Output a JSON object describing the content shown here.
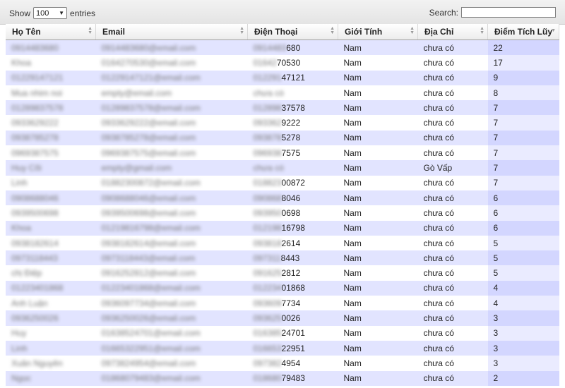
{
  "controls": {
    "show_label": "Show",
    "page_size": "100",
    "entries_label": "entries",
    "search_label": "Search:",
    "search_value": ""
  },
  "columns": [
    "Họ Tên",
    "Email",
    "Điện Thoại",
    "Giới Tính",
    "Địa Chỉ",
    "Điểm Tích Lũy"
  ],
  "rows": [
    {
      "name": "0914483680",
      "email": "0914483680@email.com",
      "phone_hidden": "0914483",
      "phone_visible": "680",
      "gender": "Nam",
      "address": "chưa có",
      "points": "22"
    },
    {
      "name": "Khoa",
      "email": "0164270530@email.com",
      "phone_hidden": "01642",
      "phone_visible": "70530",
      "gender": "Nam",
      "address": "chưa có",
      "points": "17"
    },
    {
      "name": "01229147121",
      "email": "01229147121@email.com",
      "phone_hidden": "012291",
      "phone_visible": "47121",
      "gender": "Nam",
      "address": "chưa có",
      "points": "9"
    },
    {
      "name": "Mua nhim noi",
      "email": "empty@email.com",
      "phone_hidden": "chưa có",
      "phone_visible": "",
      "gender": "Nam",
      "address": "chưa có",
      "points": "8"
    },
    {
      "name": "01289837578",
      "email": "01289837578@email.com",
      "phone_hidden": "012898",
      "phone_visible": "37578",
      "gender": "Nam",
      "address": "chưa có",
      "points": "7"
    },
    {
      "name": "0933629222",
      "email": "0933629222@email.com",
      "phone_hidden": "093362",
      "phone_visible": "9222",
      "gender": "Nam",
      "address": "chưa có",
      "points": "7"
    },
    {
      "name": "0938785278",
      "email": "0938785278@email.com",
      "phone_hidden": "093878",
      "phone_visible": "5278",
      "gender": "Nam",
      "address": "chưa có",
      "points": "7"
    },
    {
      "name": "0969387575",
      "email": "0969387575@email.com",
      "phone_hidden": "096938",
      "phone_visible": "7575",
      "gender": "Nam",
      "address": "chưa có",
      "points": "7"
    },
    {
      "name": "Huy Cõi",
      "email": "empty@gmail.com",
      "phone_hidden": "chưa có",
      "phone_visible": "",
      "gender": "Nam",
      "address": "Gò Vấp",
      "points": "7"
    },
    {
      "name": "Linh",
      "email": "01882300872@email.com",
      "phone_hidden": "018823",
      "phone_visible": "00872",
      "gender": "Nam",
      "address": "chưa có",
      "points": "7"
    },
    {
      "name": "0908688046",
      "email": "0908688046@email.com",
      "phone_hidden": "090868",
      "phone_visible": "8046",
      "gender": "Nam",
      "address": "chưa có",
      "points": "6"
    },
    {
      "name": "0939500698",
      "email": "0939500698@email.com",
      "phone_hidden": "093950",
      "phone_visible": "0698",
      "gender": "Nam",
      "address": "chưa có",
      "points": "6"
    },
    {
      "name": "Khoa",
      "email": "01219816798@email.com",
      "phone_hidden": "012198",
      "phone_visible": "16798",
      "gender": "Nam",
      "address": "chưa có",
      "points": "6"
    },
    {
      "name": "0938182614",
      "email": "0938182614@email.com",
      "phone_hidden": "093818",
      "phone_visible": "2614",
      "gender": "Nam",
      "address": "chưa có",
      "points": "5"
    },
    {
      "name": "0973118443",
      "email": "0973118443@email.com",
      "phone_hidden": "097311",
      "phone_visible": "8443",
      "gender": "Nam",
      "address": "chưa có",
      "points": "5"
    },
    {
      "name": "chị Điệp",
      "email": "0916252812@email.com",
      "phone_hidden": "091625",
      "phone_visible": "2812",
      "gender": "Nam",
      "address": "chưa có",
      "points": "5"
    },
    {
      "name": "01223401868",
      "email": "01223401868@email.com",
      "phone_hidden": "012234",
      "phone_visible": "01868",
      "gender": "Nam",
      "address": "chưa có",
      "points": "4"
    },
    {
      "name": "Anh Luận",
      "email": "0936097734@email.com",
      "phone_hidden": "093609",
      "phone_visible": "7734",
      "gender": "Nam",
      "address": "chưa có",
      "points": "4"
    },
    {
      "name": "0936250026",
      "email": "0936250026@email.com",
      "phone_hidden": "093625",
      "phone_visible": "0026",
      "gender": "Nam",
      "address": "chưa có",
      "points": "3"
    },
    {
      "name": "Huy",
      "email": "01638524701@email.com",
      "phone_hidden": "016385",
      "phone_visible": "24701",
      "gender": "Nam",
      "address": "chưa có",
      "points": "3"
    },
    {
      "name": "Linh",
      "email": "01665322951@email.com",
      "phone_hidden": "016653",
      "phone_visible": "22951",
      "gender": "Nam",
      "address": "chưa có",
      "points": "3"
    },
    {
      "name": "Xuân Nguyên",
      "email": "0973824954@email.com",
      "phone_hidden": "097382",
      "phone_visible": "4954",
      "gender": "Nam",
      "address": "chưa có",
      "points": "3"
    },
    {
      "name": "Ngọc",
      "email": "01868079483@email.com",
      "phone_hidden": "018680",
      "phone_visible": "79483",
      "gender": "Nam",
      "address": "chưa có",
      "points": "2"
    }
  ]
}
